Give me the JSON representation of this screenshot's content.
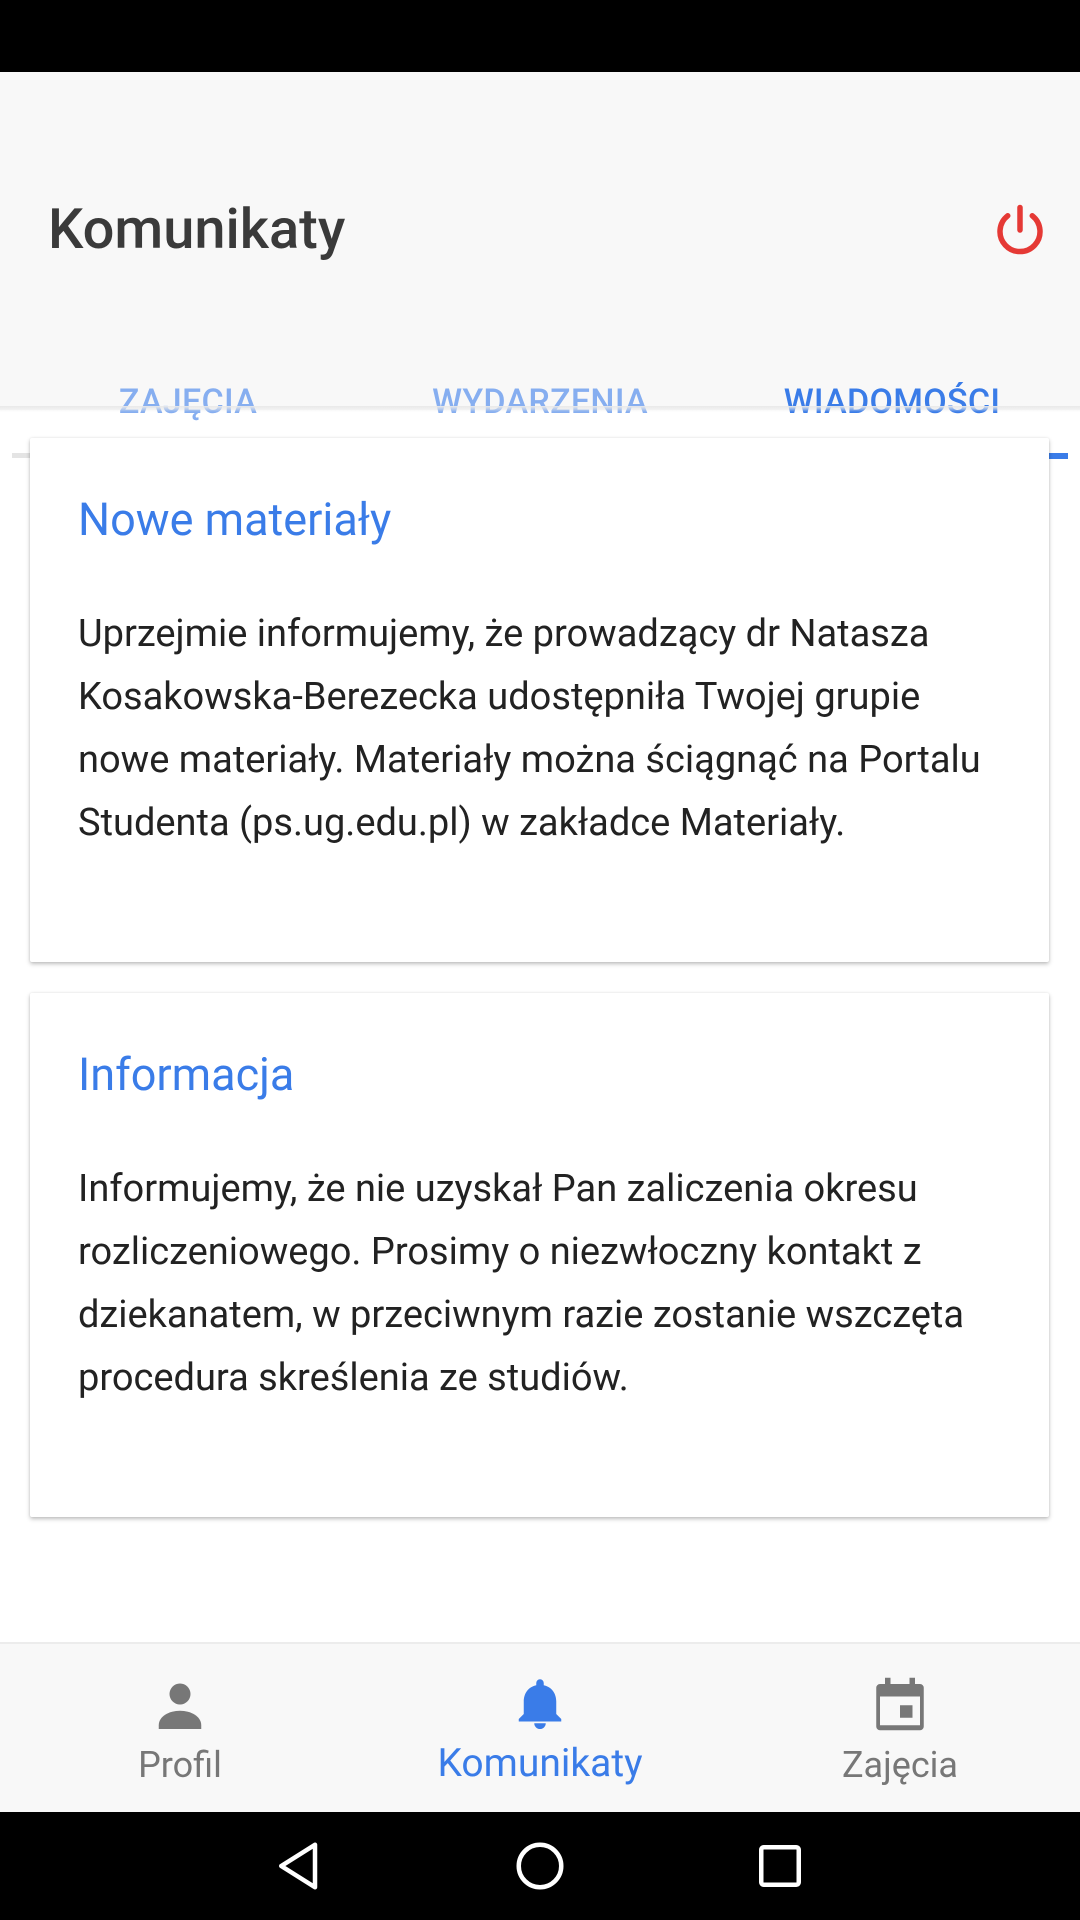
{
  "header": {
    "title": "Komunikaty",
    "power_icon": "power-icon",
    "power_color": "#e53935"
  },
  "tabs": [
    {
      "label": "ZAJĘCIA",
      "active": false
    },
    {
      "label": "WYDARZENIA",
      "active": false
    },
    {
      "label": "WIADOMOŚCI",
      "active": true
    }
  ],
  "messages": [
    {
      "title": "Nowe materiały",
      "body": "Uprzejmie informujemy, że prowadzący dr Natasza Kosakowska-Berezecka udostępniła Twojej grupie nowe materiały. Materiały można ściągnąć na Portalu Studenta (ps.ug.edu.pl) w zakładce Materiały."
    },
    {
      "title": "Informacja",
      "body": "Informujemy, że nie uzyskał Pan zaliczenia okresu rozliczeniowego. Prosimy o niezwłoczny kontakt z dziekanatem, w przeciwnym razie zostanie wszczęta procedura skreślenia ze studiów."
    }
  ],
  "bottom_nav": [
    {
      "label": "Profil",
      "icon": "person-icon",
      "active": false
    },
    {
      "label": "Komunikaty",
      "icon": "bell-icon",
      "active": true
    },
    {
      "label": "Zajęcia",
      "icon": "calendar-icon",
      "active": false
    }
  ],
  "colors": {
    "accent": "#3a7ce8",
    "inactive_tab": "#86aef0",
    "inactive_nav": "#777777"
  }
}
